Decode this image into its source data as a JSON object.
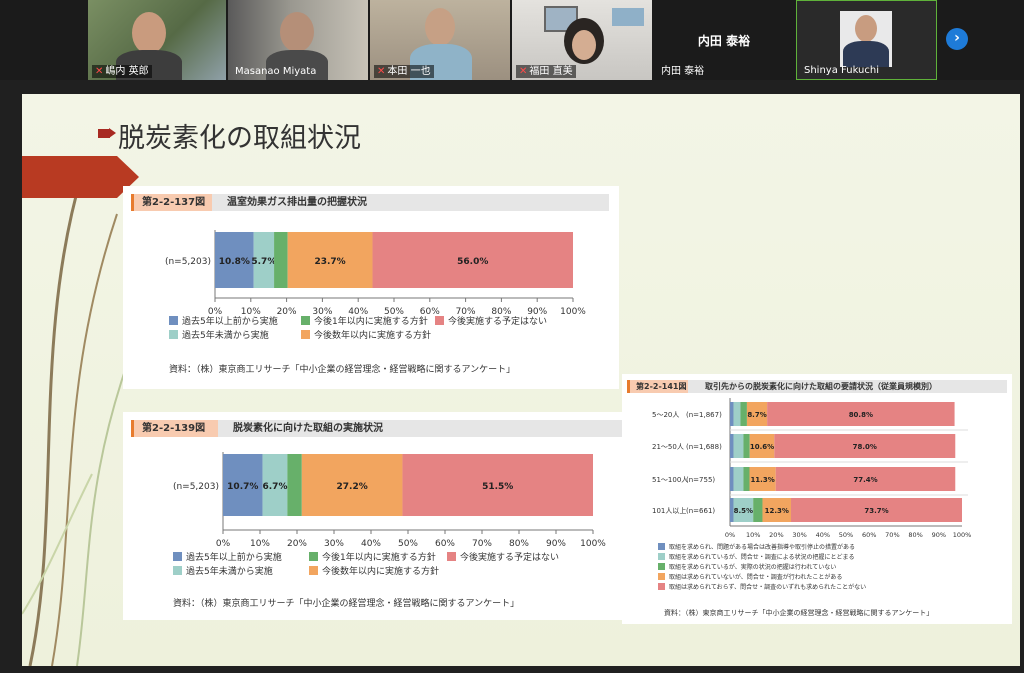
{
  "participants": [
    {
      "name": "嶋内 英郎",
      "muted": true
    },
    {
      "name": "Masanao Miyata",
      "muted": false
    },
    {
      "name": "本田 一也",
      "muted": true
    },
    {
      "name": "福田 直美",
      "muted": true
    },
    {
      "name": "内田 泰裕",
      "display_name": "内田 泰裕",
      "muted": false
    },
    {
      "name": "Shinya Fukuchi",
      "muted": false
    }
  ],
  "colors": {
    "s1": "#6f8fbf",
    "s2": "#9ecfc8",
    "s3": "#67b06a",
    "s4": "#f2a55f",
    "s5": "#e58383"
  },
  "slide": {
    "title": "脱炭素化の取組状況"
  },
  "chart137": {
    "number": "第2-2-137図",
    "title": "温室効果ガス排出量の把握状況",
    "legend": [
      "過去5年以上前から実施",
      "過去5年未満から実施",
      "今後1年以内に実施する方針",
      "今後数年以内に実施する方針",
      "今後実施する予定はない"
    ],
    "source": "資料：（株）東京商工リサーチ「中小企業の経営理念・経営戦略に関するアンケート」"
  },
  "chart139": {
    "number": "第2-2-139図",
    "title": "脱炭素化に向けた取組の実施状況",
    "legend": [
      "過去5年以上前から実施",
      "過去5年未満から実施",
      "今後1年以内に実施する方針",
      "今後数年以内に実施する方針",
      "今後実施する予定はない"
    ],
    "source": "資料：（株）東京商工リサーチ「中小企業の経営理念・経営戦略に関するアンケート」"
  },
  "chart141": {
    "number": "第2-2-141図",
    "title": "取引先からの脱炭素化に向けた取組の要請状況（従業員規模別）",
    "legend": [
      "取組を求められ、問題がある場合は改善指導や取引停止の措置がある",
      "取組を求められているが、問合せ・調査による状況の把握にとどまる",
      "取組を求められているが、実際の状況の把握は行われていない",
      "取組は求められていないが、問合せ・調査が行われたことがある",
      "取組は求められておらず、問合せ・調査のいずれも求められたことがない"
    ],
    "source": "資料：（株）東京商工リサーチ「中小企業の経営理念・経営戦略に関するアンケート」"
  },
  "chart_data": [
    {
      "type": "bar",
      "orientation": "horizontal",
      "stacked": true,
      "categories": [
        "(n=5,203)"
      ],
      "series": [
        {
          "name": "過去5年以上前から実施",
          "values": [
            10.8
          ],
          "label": "10.8%"
        },
        {
          "name": "過去5年未満から実施",
          "values": [
            5.7
          ],
          "label": "5.7%"
        },
        {
          "name": "今後1年以内に実施する方針",
          "values": [
            3.8
          ],
          "label": ""
        },
        {
          "name": "今後数年以内に実施する方針",
          "values": [
            23.7
          ],
          "label": "23.7%"
        },
        {
          "name": "今後実施する予定はない",
          "values": [
            56.0
          ],
          "label": "56.0%"
        }
      ],
      "xlim": [
        0,
        100
      ],
      "ticks": [
        "0%",
        "10%",
        "20%",
        "30%",
        "40%",
        "50%",
        "60%",
        "70%",
        "80%",
        "90%",
        "100%"
      ]
    },
    {
      "type": "bar",
      "orientation": "horizontal",
      "stacked": true,
      "categories": [
        "(n=5,203)"
      ],
      "series": [
        {
          "name": "過去5年以上前から実施",
          "values": [
            10.7
          ],
          "label": "10.7%"
        },
        {
          "name": "過去5年未満から実施",
          "values": [
            6.7
          ],
          "label": "6.7%"
        },
        {
          "name": "今後1年以内に実施する方針",
          "values": [
            3.9
          ],
          "label": ""
        },
        {
          "name": "今後数年以内に実施する方針",
          "values": [
            27.2
          ],
          "label": "27.2%"
        },
        {
          "name": "今後実施する予定はない",
          "values": [
            51.5
          ],
          "label": "51.5%"
        }
      ],
      "xlim": [
        0,
        100
      ],
      "ticks": [
        "0%",
        "10%",
        "20%",
        "30%",
        "40%",
        "50%",
        "60%",
        "70%",
        "80%",
        "90%",
        "100%"
      ]
    },
    {
      "type": "bar",
      "orientation": "horizontal",
      "stacked": true,
      "categories": [
        "5～20人",
        "21～50人",
        "51～100人",
        "101人以上"
      ],
      "category_n": [
        "(n=1,867)",
        "(n=1,688)",
        "(n=755)",
        "(n=661)"
      ],
      "series": [
        {
          "name": "取組を求められ、問題がある場合は改善指導や取引停止の措置がある",
          "values": [
            1.5,
            1.5,
            1.5,
            1.5
          ],
          "labels": [
            "",
            "",
            "",
            ""
          ]
        },
        {
          "name": "取組を求められているが、問合せ・調査による状況の把握にとどまる",
          "values": [
            3.0,
            4.3,
            4.3,
            8.5
          ],
          "labels": [
            "",
            "",
            "",
            "8.5%"
          ]
        },
        {
          "name": "取組を求められているが、実際の状況の把握は行われていない",
          "values": [
            2.8,
            2.7,
            2.6,
            4.0
          ],
          "labels": [
            "",
            "",
            "",
            ""
          ]
        },
        {
          "name": "取組は求められていないが、問合せ・調査が行われたことがある",
          "values": [
            8.7,
            10.6,
            11.3,
            12.3
          ],
          "labels": [
            "8.7%",
            "10.6%",
            "11.3%",
            "12.3%"
          ]
        },
        {
          "name": "取組は求められておらず、問合せ・調査のいずれも求められたことがない",
          "values": [
            80.8,
            78.0,
            77.4,
            73.7
          ],
          "labels": [
            "80.8%",
            "78.0%",
            "77.4%",
            "73.7%"
          ]
        }
      ],
      "xlim": [
        0,
        100
      ],
      "ticks": [
        "0%",
        "10%",
        "20%",
        "30%",
        "40%",
        "50%",
        "60%",
        "70%",
        "80%",
        "90%",
        "100%"
      ]
    }
  ]
}
